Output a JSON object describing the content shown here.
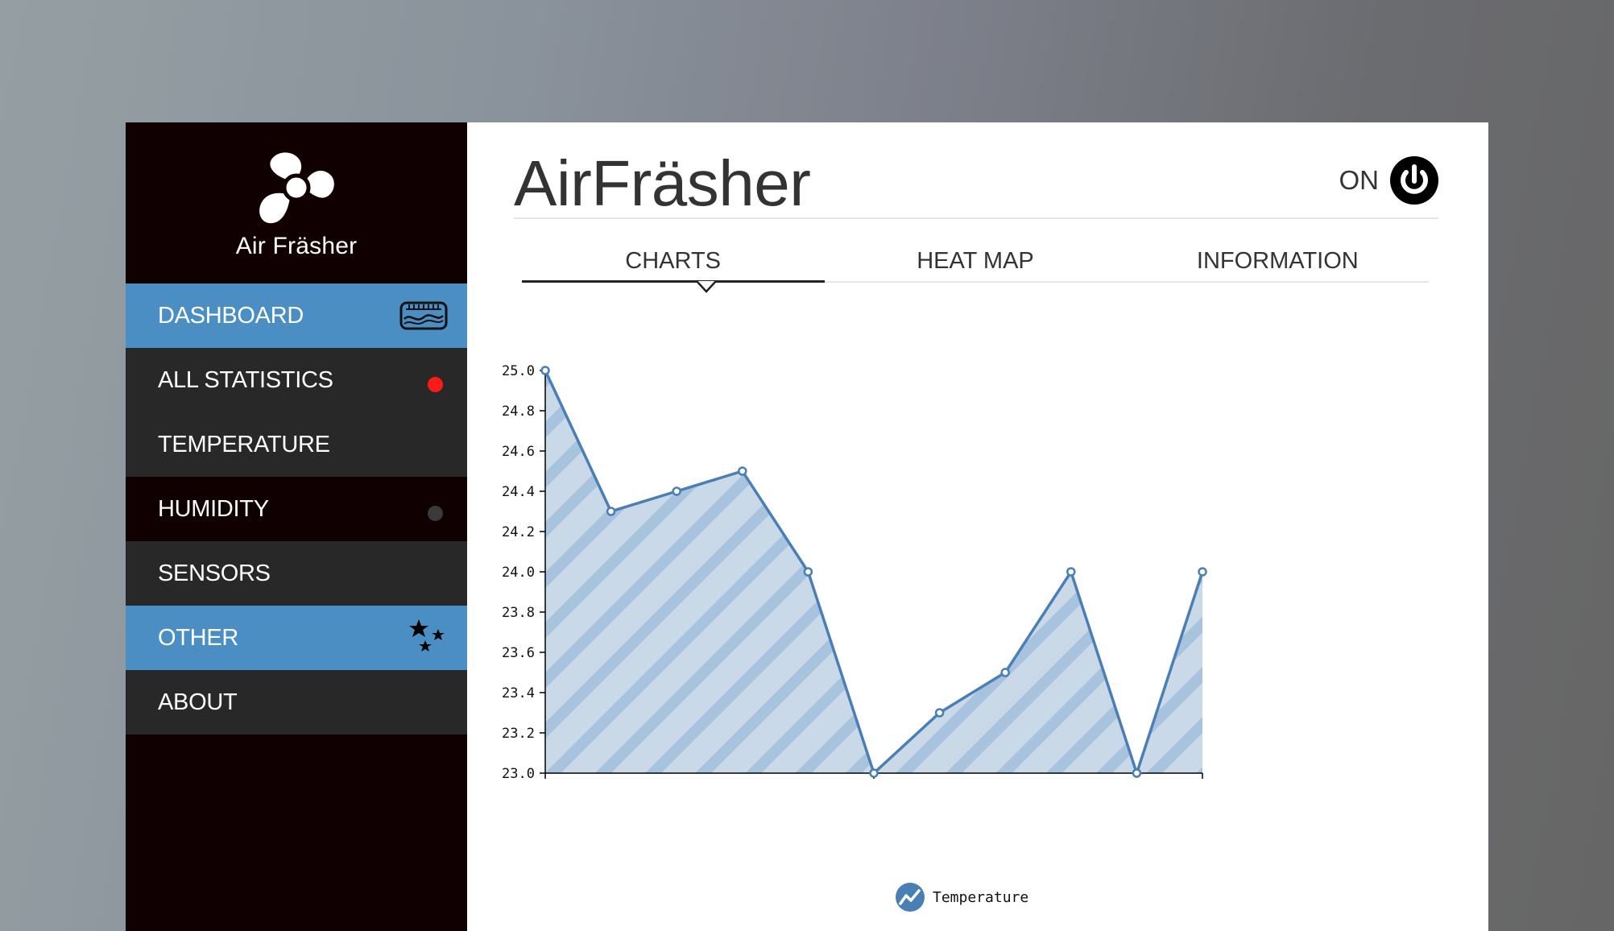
{
  "brand": {
    "name": "Air Fräsher",
    "logo_icon": "fan-icon"
  },
  "sidebar": {
    "items": [
      {
        "label": "DASHBOARD",
        "icon": "gauge-icon"
      },
      {
        "label": "ALL STATISTICS",
        "icon": "red-dot-indicator"
      },
      {
        "label": "TEMPERATURE"
      },
      {
        "label": "HUMIDITY",
        "icon": "gray-dot-indicator"
      },
      {
        "label": "SENSORS"
      },
      {
        "label": "OTHER",
        "icon": "stars-icon"
      },
      {
        "label": "ABOUT"
      }
    ]
  },
  "header": {
    "title": "AirFräsher",
    "power_label": "ON",
    "power_icon": "power-icon"
  },
  "tabs": [
    {
      "label": "CHARTS",
      "active": true
    },
    {
      "label": "HEAT MAP",
      "active": false
    },
    {
      "label": "INFORMATION",
      "active": false
    }
  ],
  "colors": {
    "accent": "#4a8ec4",
    "sidebar_bg": "#110001",
    "sidebar_gray": "#282828",
    "line": "#4a7fb5",
    "fill": "#c9d9e8",
    "stripe": "#a7c3de",
    "status_red": "#ff1a1a"
  },
  "chart_data": {
    "type": "area",
    "title": "",
    "xlabel": "",
    "ylabel": "",
    "x": [
      0,
      1,
      2,
      3,
      4,
      5,
      6,
      7,
      8,
      9,
      10
    ],
    "series": [
      {
        "name": "Temperature",
        "values": [
          25.0,
          24.3,
          24.4,
          24.5,
          24.0,
          23.0,
          23.3,
          23.5,
          24.0,
          23.0,
          24.0
        ]
      }
    ],
    "xlim": [
      0,
      10
    ],
    "ylim": [
      23.0,
      25.0
    ],
    "x_ticks": [
      "0",
      "5",
      "10"
    ],
    "y_ticks": [
      "23.0",
      "23.2",
      "23.4",
      "23.6",
      "23.8",
      "24.0",
      "24.2",
      "24.4",
      "24.6",
      "24.8",
      "25.0"
    ],
    "grid": false,
    "legend": "bottom-left",
    "legend_icon": "trend-line-icon"
  }
}
